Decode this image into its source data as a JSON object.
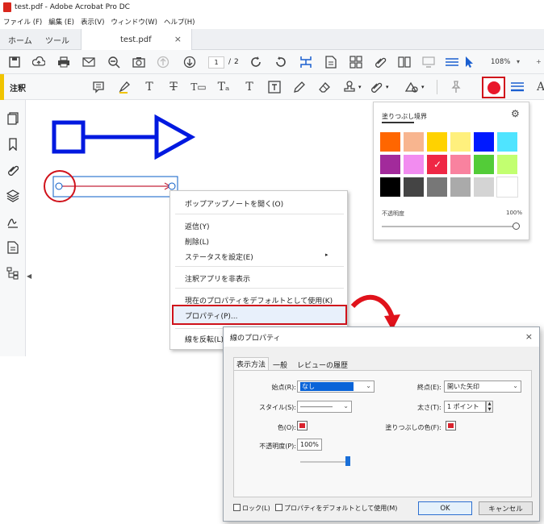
{
  "window": {
    "title": "test.pdf - Adobe Acrobat Pro DC"
  },
  "menu": [
    "ファイル (F)",
    "編集 (E)",
    "表示(V)",
    "ウィンドウ(W)",
    "ヘルプ(H)"
  ],
  "tabs": {
    "home": "ホーム",
    "tools": "ツール",
    "doc": "test.pdf",
    "close": "×"
  },
  "toolbar": {
    "page_current": "1",
    "page_sep": "/",
    "page_total": "2",
    "zoom": "108%"
  },
  "commentbar": {
    "label": "注釈"
  },
  "context_menu": {
    "items": [
      "ポップアップノートを開く(O)",
      "返信(Y)",
      "削除(L)",
      "ステータスを設定(E)",
      "注釈アプリを非表示",
      "現在のプロパティをデフォルトとして使用(K)",
      "プロパティ(P)...",
      "線を反転(L)"
    ]
  },
  "color_panel": {
    "tab_fill": "塗りつぶし",
    "tab_border": "境界",
    "opacity_label": "不透明度",
    "opacity_value": "100%",
    "colors": [
      "#ff6600",
      "#f8b58f",
      "#ffd200",
      "#fff07d",
      "#0019ff",
      "#4fe4ff",
      "#a22a9b",
      "#f28cf0",
      "#ef2745",
      "#f9829f",
      "#53cc38",
      "#c2ff70",
      "#000000",
      "#444444",
      "#777777",
      "#aaaaaa",
      "#d4d4d4",
      "#ffffff"
    ],
    "selected_index": 8
  },
  "dialog": {
    "title": "線のプロパティ",
    "tabs": [
      "表示方法",
      "一般",
      "レビューの履歴"
    ],
    "start_label": "始点(R):",
    "start_value": "なし",
    "end_label": "終点(E):",
    "end_value": "開いた矢印",
    "style_label": "スタイル(S):",
    "style_value": "―――――",
    "thickness_label": "太さ(T):",
    "thickness_value": "1 ポイント",
    "color_label": "色(O):",
    "fill_color_label": "塗りつぶしの色(F):",
    "opacity_label": "不透明度(P):",
    "opacity_value": "100%",
    "lock_label": "ロック(L)",
    "default_label": "プロパティをデフォルトとして使用(M)",
    "ok": "OK",
    "cancel": "キャンセル",
    "close": "×"
  },
  "accent": {
    "red": "#d0121b",
    "blue": "#0019e0",
    "highlight": "#e8f0fb"
  }
}
